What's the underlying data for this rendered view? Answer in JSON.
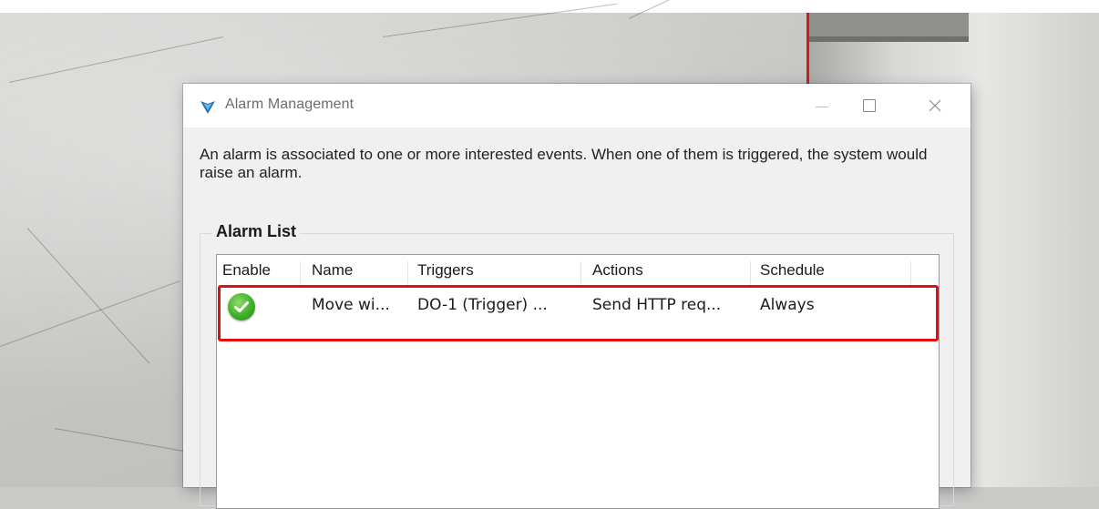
{
  "window": {
    "title": "Alarm Management",
    "close_glyph": "×"
  },
  "description": "An alarm is associated to one or more interested events. When one of them is triggered, the system would raise an alarm.",
  "alarm_list": {
    "group_label": "Alarm List",
    "columns": [
      "Enable",
      "Name",
      "Triggers",
      "Actions",
      "Schedule"
    ],
    "rows": [
      {
        "enable_icon": "green-check-icon",
        "name": "Move wi...",
        "triggers": "DO-1 (Trigger) ...",
        "actions": "Send HTTP req...",
        "schedule": "Always"
      }
    ]
  },
  "colors": {
    "highlight": "#e01010",
    "enabled": "#3fae2a"
  }
}
